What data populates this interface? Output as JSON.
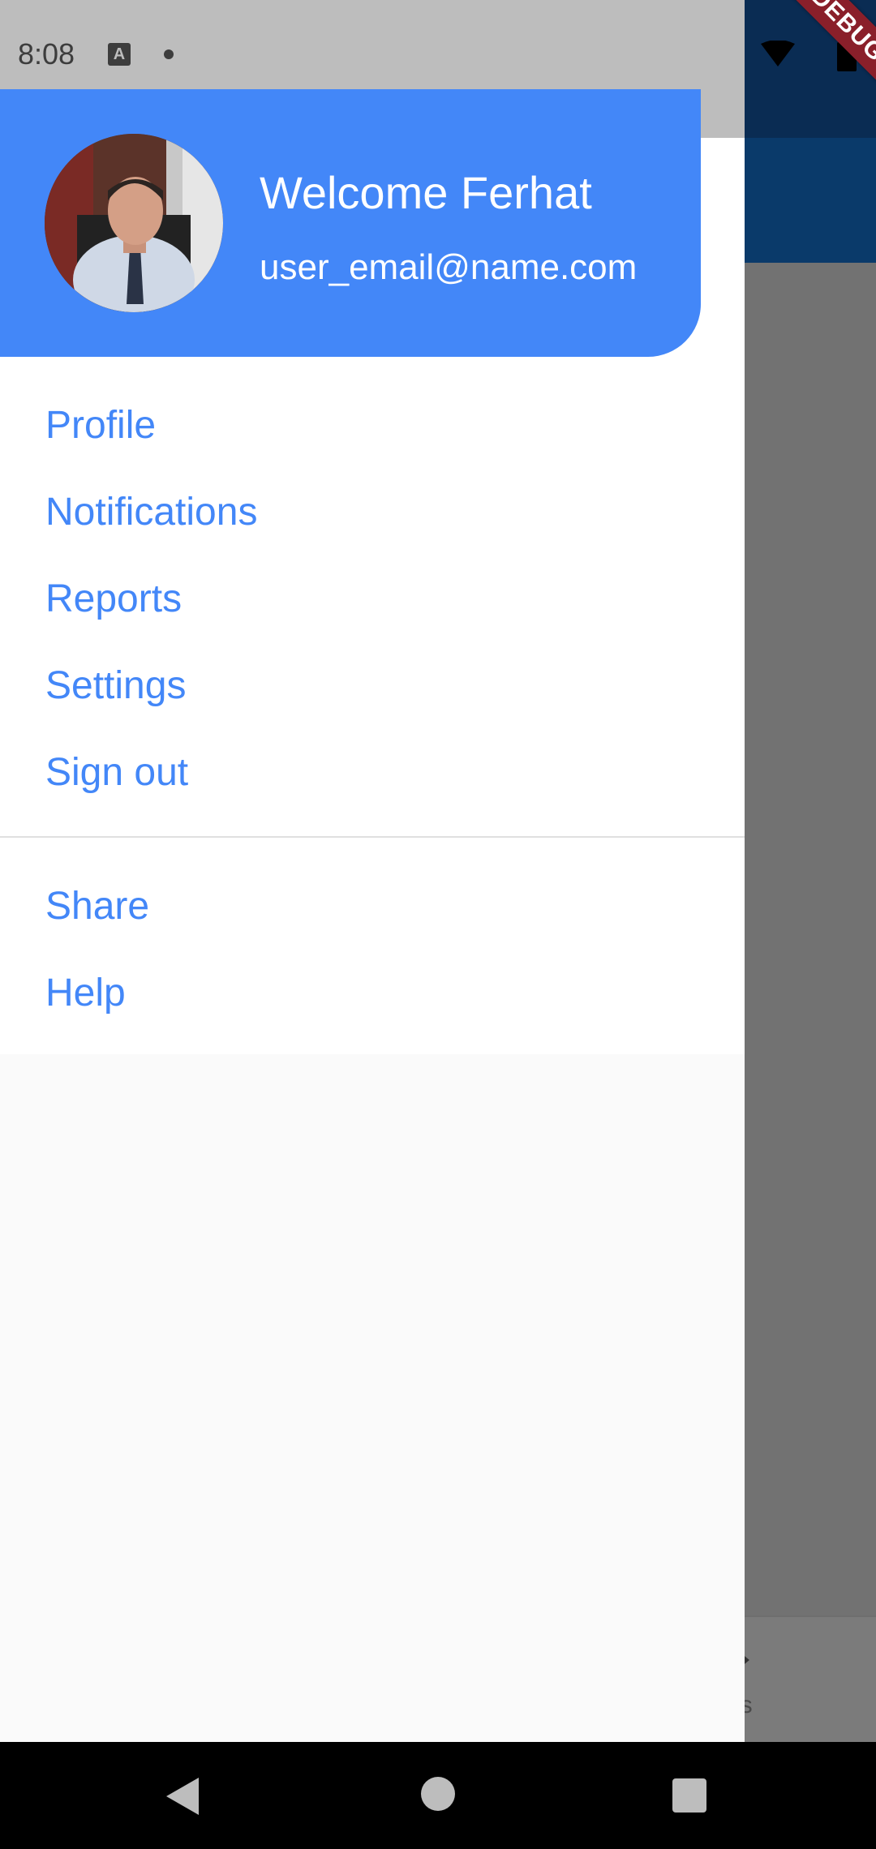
{
  "status_bar": {
    "time": "8:08"
  },
  "debug_banner": "DEBUG",
  "background_app": {
    "bottom_nav_partial_label": "gs"
  },
  "drawer": {
    "header": {
      "welcome": "Welcome Ferhat",
      "email": "user_email@name.com",
      "accent_color": "#4387f8"
    },
    "menu_items": [
      {
        "label": "Profile"
      },
      {
        "label": "Notifications"
      },
      {
        "label": "Reports"
      },
      {
        "label": "Settings"
      },
      {
        "label": "Sign out"
      }
    ],
    "secondary_items": [
      {
        "label": "Share"
      },
      {
        "label": "Help"
      }
    ]
  }
}
